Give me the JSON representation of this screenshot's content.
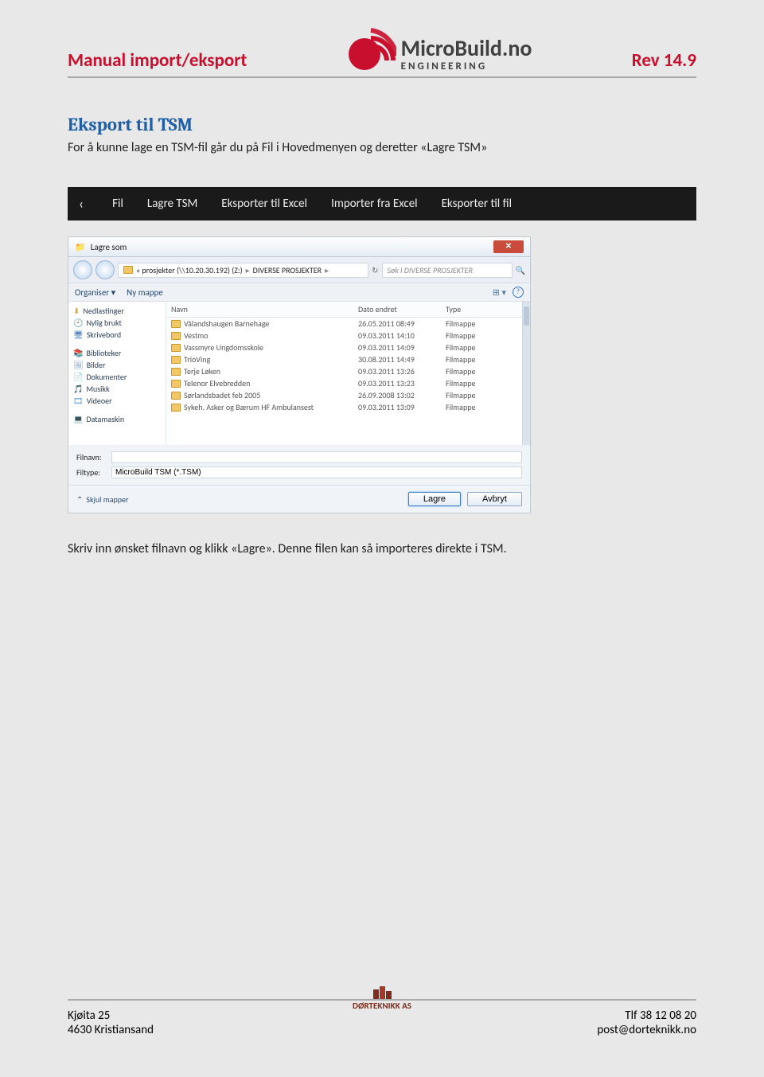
{
  "header": {
    "left": "Manual import/eksport",
    "logo_main": "MicroBuild.no",
    "logo_sub": "ENGINEERING",
    "right": "Rev 14.9"
  },
  "section": {
    "title": "Eksport til TSM",
    "intro": "For å kunne lage en TSM-fil går du på Fil i Hovedmenyen og deretter «Lagre TSM»"
  },
  "menubar": {
    "items": [
      "Fil",
      "Lagre TSM",
      "Eksporter til Excel",
      "Importer fra Excel",
      "Eksporter til fil"
    ]
  },
  "dialog": {
    "title": "Lagre som",
    "breadcrumb": [
      "« prosjekter (\\\\10.20.30.192) (Z:)",
      "DIVERSE PROSJEKTER"
    ],
    "search_placeholder": "Søk i DIVERSE PROSJEKTER",
    "toolbar": {
      "organize": "Organiser ▾",
      "new_folder": "Ny mappe"
    },
    "sidebar": [
      "Nedlastinger",
      "Nylig brukt",
      "Skrivebord",
      "",
      "Biblioteker",
      "Bilder",
      "Dokumenter",
      "Musikk",
      "Videoer",
      "",
      "Datamaskin"
    ],
    "columns": [
      "Navn",
      "Dato endret",
      "Type"
    ],
    "rows": [
      {
        "name": "Vålandshaugen Barnehage",
        "date": "26.05.2011 08:49",
        "type": "Filmappe"
      },
      {
        "name": "Vestmo",
        "date": "09.03.2011 14:10",
        "type": "Filmappe"
      },
      {
        "name": "Vassmyre Ungdomsskole",
        "date": "09.03.2011 14:09",
        "type": "Filmappe"
      },
      {
        "name": "TrioVing",
        "date": "30.08.2011 14:49",
        "type": "Filmappe"
      },
      {
        "name": "Terje Løken",
        "date": "09.03.2011 13:26",
        "type": "Filmappe"
      },
      {
        "name": "Telenor Elvebredden",
        "date": "09.03.2011 13:23",
        "type": "Filmappe"
      },
      {
        "name": "Sørlandsbadet feb 2005",
        "date": "26.09.2008 13:02",
        "type": "Filmappe"
      },
      {
        "name": "Sykeh. Asker og Bærum HF Ambulansest",
        "date": "09.03.2011 13:09",
        "type": "Filmappe"
      }
    ],
    "filename_label": "Filnavn:",
    "filename_value": "",
    "filetype_label": "Filtype:",
    "filetype_value": "MicroBuild TSM (*.TSM)",
    "hide_folders": "Skjul mapper",
    "save_btn": "Lagre",
    "cancel_btn": "Avbryt"
  },
  "body2": "Skriv inn ønsket filnavn og klikk «Lagre». Denne filen kan så importeres direkte i TSM.",
  "footer": {
    "addr1": "Kjøita 25",
    "addr2": "4630 Kristiansand",
    "logo": "DØRTEKNIKK AS",
    "phone": "Tlf 38 12 08 20",
    "email": "post@dorteknikk.no"
  }
}
